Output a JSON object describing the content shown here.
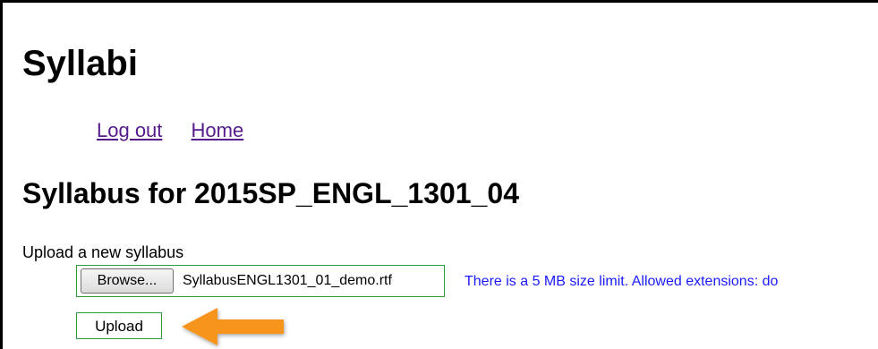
{
  "page": {
    "title": "Syllabi"
  },
  "nav": {
    "logout_label": "Log out",
    "home_label": "Home"
  },
  "syllabus": {
    "heading": "Syllabus for 2015SP_ENGL_1301_04",
    "upload_label": "Upload a new syllabus",
    "browse_label": "Browse...",
    "selected_file": "SyllabusENGL1301_01_demo.rtf",
    "size_note": "There is a 5 MB size limit. Allowed extensions: do",
    "upload_button_label": "Upload"
  },
  "annotation": {
    "arrow_icon": "arrow-left-icon",
    "arrow_color": "#f7941d"
  },
  "colors": {
    "link": "#551a8b",
    "note": "#1a1aff",
    "highlight_border": "#2a9a3a"
  }
}
